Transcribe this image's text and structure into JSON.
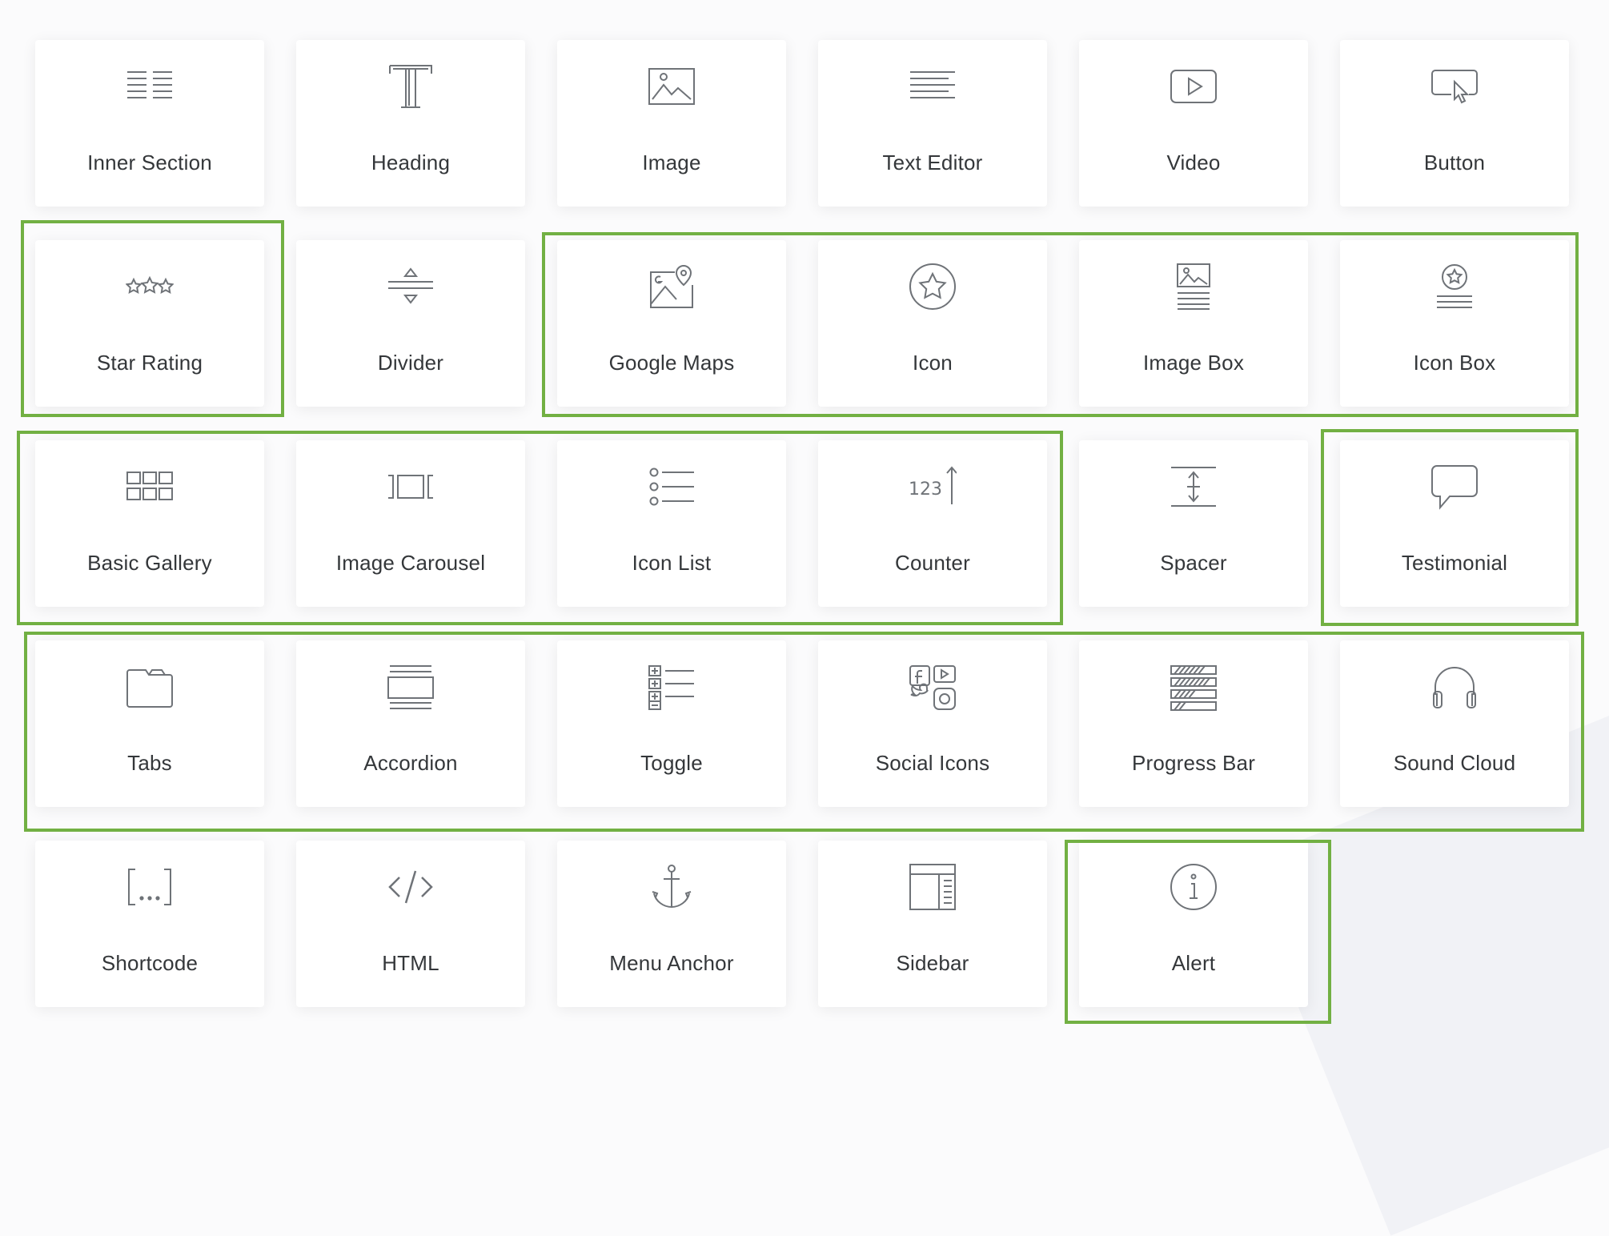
{
  "accent_color": "#72b043",
  "widgets": [
    {
      "label": "Inner Section",
      "icon": "inner-section-icon"
    },
    {
      "label": "Heading",
      "icon": "heading-icon"
    },
    {
      "label": "Image",
      "icon": "image-icon"
    },
    {
      "label": "Text Editor",
      "icon": "text-editor-icon"
    },
    {
      "label": "Video",
      "icon": "video-icon"
    },
    {
      "label": "Button",
      "icon": "button-icon"
    },
    {
      "label": "Star Rating",
      "icon": "star-rating-icon"
    },
    {
      "label": "Divider",
      "icon": "divider-icon"
    },
    {
      "label": "Google Maps",
      "icon": "google-maps-icon"
    },
    {
      "label": "Icon",
      "icon": "icon-icon"
    },
    {
      "label": "Image Box",
      "icon": "image-box-icon"
    },
    {
      "label": "Icon Box",
      "icon": "icon-box-icon"
    },
    {
      "label": "Basic Gallery",
      "icon": "basic-gallery-icon"
    },
    {
      "label": "Image Carousel",
      "icon": "image-carousel-icon"
    },
    {
      "label": "Icon List",
      "icon": "icon-list-icon"
    },
    {
      "label": "Counter",
      "icon": "counter-icon"
    },
    {
      "label": "Spacer",
      "icon": "spacer-icon"
    },
    {
      "label": "Testimonial",
      "icon": "testimonial-icon"
    },
    {
      "label": "Tabs",
      "icon": "tabs-icon"
    },
    {
      "label": "Accordion",
      "icon": "accordion-icon"
    },
    {
      "label": "Toggle",
      "icon": "toggle-icon"
    },
    {
      "label": "Social Icons",
      "icon": "social-icons-icon"
    },
    {
      "label": "Progress Bar",
      "icon": "progress-bar-icon"
    },
    {
      "label": "Sound Cloud",
      "icon": "sound-cloud-icon"
    },
    {
      "label": "Shortcode",
      "icon": "shortcode-icon"
    },
    {
      "label": "HTML",
      "icon": "html-icon"
    },
    {
      "label": "Menu Anchor",
      "icon": "menu-anchor-icon"
    },
    {
      "label": "Sidebar",
      "icon": "sidebar-icon"
    },
    {
      "label": "Alert",
      "icon": "alert-icon"
    }
  ]
}
